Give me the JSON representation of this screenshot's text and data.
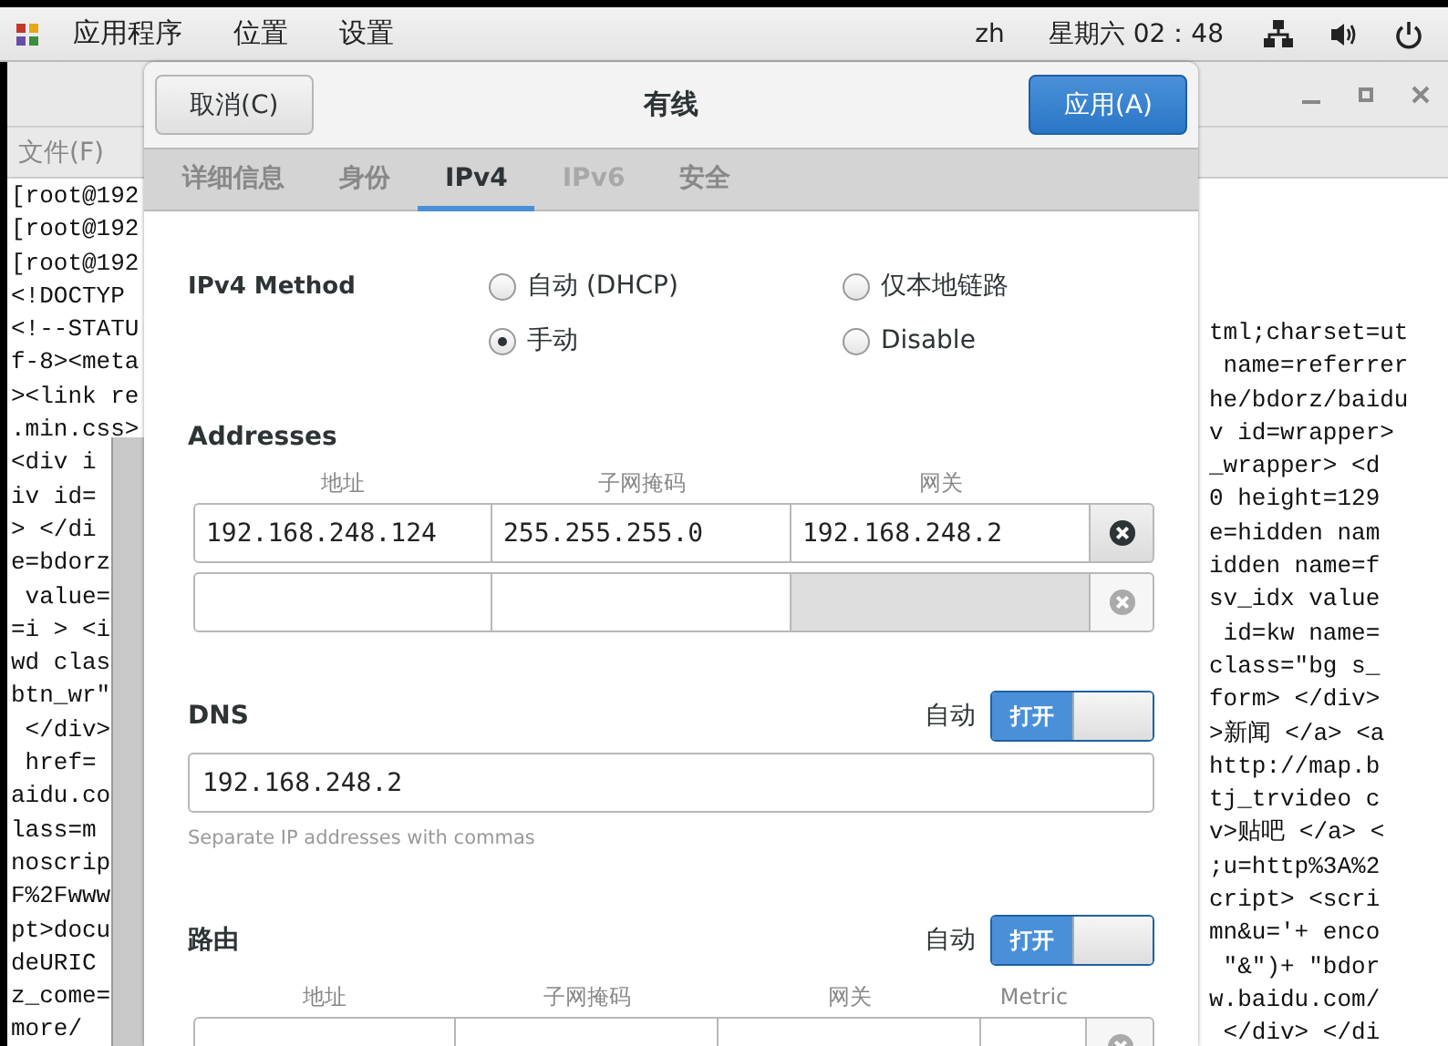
{
  "top_bar": {
    "menus": [
      "应用程序",
      "位置",
      "设置"
    ],
    "input_method": "zh",
    "clock": "星期六 02：48"
  },
  "terminal": {
    "menu": [
      "文件(F)"
    ],
    "left_lines": [
      "[root@192",
      "[root@192",
      "[root@192",
      "<!DOCTYP",
      "<!--STATU",
      "f-8><meta",
      "><link re",
      ".min.css>",
      "<div i",
      "iv id=",
      "> </di",
      "e=bdorz",
      " value=",
      "=i > <i",
      "wd clas",
      "btn_wr\"",
      " </div>",
      " href=",
      "aidu.co",
      "lass=m",
      "noscrip",
      "F%2Fwww",
      "pt>docu",
      "deURIC",
      "z_come=",
      "more/"
    ],
    "right_lines": [
      "tml;charset=ut",
      " name=referrer",
      "he/bdorz/baidu",
      "v id=wrapper>",
      "_wrapper> <d",
      "0 height=129",
      "e=hidden nam",
      "idden name=f",
      "sv_idx value",
      " id=kw name=",
      "class=\"bg s_",
      "form> </div>",
      ">新闻 </a> <a",
      "http://map.b",
      "tj_trvideo c",
      "v>贴吧 </a> <",
      ";u=http%3A%2",
      "cript> <scri",
      "mn&u='+ enco",
      " \"&\")+ \"bdor",
      "w.baidu.com/",
      " </div> </di"
    ]
  },
  "dialog": {
    "title": "有线",
    "cancel": "取消(C)",
    "apply": "应用(A)",
    "tabs": [
      {
        "label": "详细信息",
        "selected": false,
        "disabled": false
      },
      {
        "label": "身份",
        "selected": false,
        "disabled": false
      },
      {
        "label": "IPv4",
        "selected": true,
        "disabled": false
      },
      {
        "label": "IPv6",
        "selected": false,
        "disabled": true
      },
      {
        "label": "安全",
        "selected": false,
        "disabled": false
      }
    ],
    "ipv4_method": {
      "label": "IPv4 Method",
      "options": [
        {
          "label": "自动 (DHCP)",
          "selected": false
        },
        {
          "label": "仅本地链路",
          "selected": false
        },
        {
          "label": "手动",
          "selected": true
        },
        {
          "label": "Disable",
          "selected": false
        }
      ]
    },
    "addresses": {
      "title": "Addresses",
      "columns": [
        "地址",
        "子网掩码",
        "网关"
      ],
      "rows": [
        {
          "cells": [
            {
              "value": "192.168.248.124",
              "disabled": false
            },
            {
              "value": "255.255.255.0",
              "disabled": false
            },
            {
              "value": "192.168.248.2",
              "disabled": false
            }
          ],
          "removable": true
        },
        {
          "cells": [
            {
              "disabled": false
            },
            {
              "disabled": false
            },
            {
              "disabled": true
            }
          ],
          "removable": false
        }
      ]
    },
    "dns": {
      "title": "DNS",
      "auto_label": "自动",
      "switch": {
        "label": "打开",
        "on": true
      },
      "value": "192.168.248.2",
      "hint": "Separate IP addresses with commas"
    },
    "routes": {
      "title": "路由",
      "auto_label": "自动",
      "switch": {
        "label": "打开",
        "on": true
      },
      "columns": [
        "地址",
        "子网掩码",
        "网关",
        "Metric"
      ],
      "rows": [
        {
          "cells": [
            {
              "disabled": false
            },
            {
              "disabled": false
            },
            {
              "disabled": false
            },
            {
              "disabled": false
            }
          ],
          "removable": false
        }
      ]
    }
  }
}
